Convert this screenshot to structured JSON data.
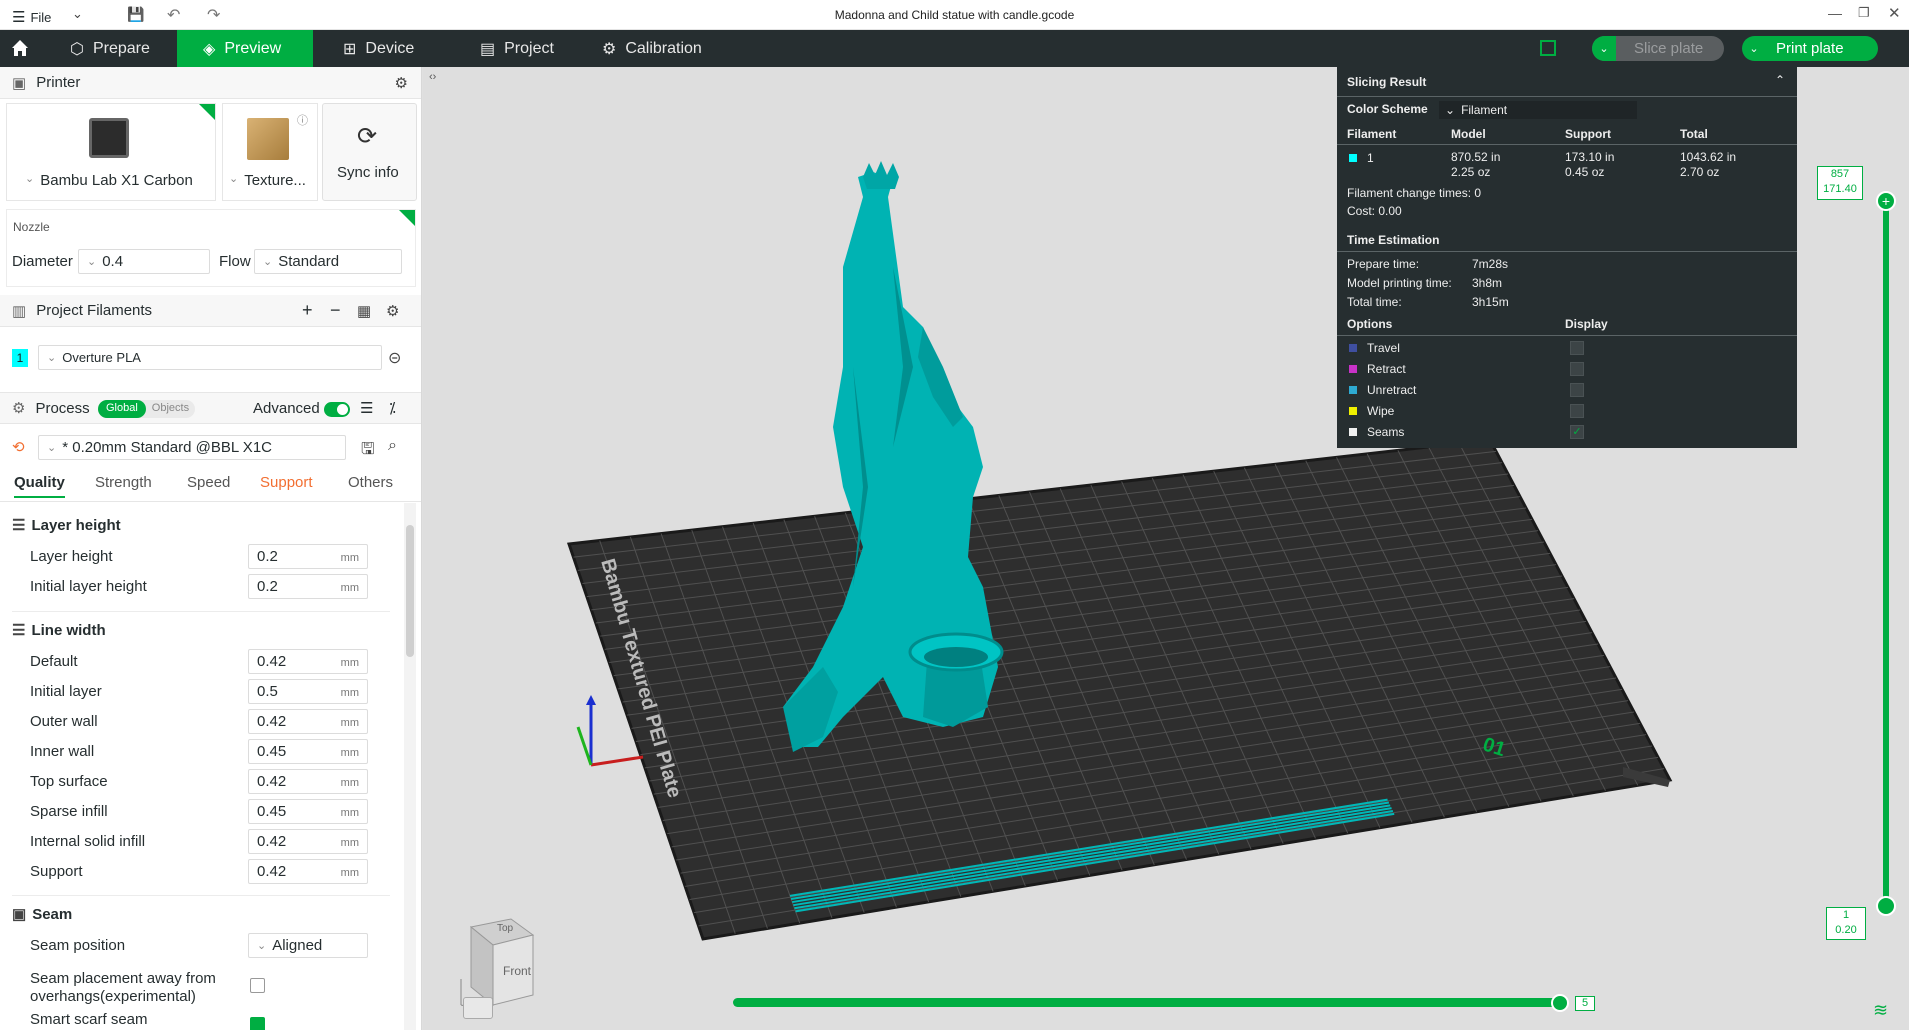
{
  "titlebar": {
    "file_label": "File",
    "title": "Madonna and Child statue with candle.gcode"
  },
  "nav": {
    "tabs": [
      {
        "label": "Prepare"
      },
      {
        "label": "Preview"
      },
      {
        "label": "Device"
      },
      {
        "label": "Project"
      },
      {
        "label": "Calibration"
      }
    ],
    "slice_label": "Slice plate",
    "print_label": "Print plate"
  },
  "printer": {
    "section_title": "Printer",
    "printer_name": "Bambu Lab X1 Carbon",
    "plate_name": "Texture...",
    "sync_label": "Sync info",
    "nozzle_title": "Nozzle",
    "diameter_label": "Diameter",
    "diameter_value": "0.4",
    "flow_label": "Flow",
    "flow_value": "Standard"
  },
  "filaments": {
    "section_title": "Project Filaments",
    "items": [
      {
        "index": "1",
        "name": "Overture PLA",
        "color": "#00ffff"
      }
    ]
  },
  "process": {
    "section_title": "Process",
    "global_label": "Global",
    "objects_label": "Objects",
    "advanced_label": "Advanced",
    "preset": "* 0.20mm Standard @BBL X1C",
    "tabs": [
      "Quality",
      "Strength",
      "Speed",
      "Support",
      "Others"
    ],
    "groups": [
      {
        "title": "Layer height",
        "params": [
          {
            "label": "Layer height",
            "value": "0.2",
            "unit": "mm"
          },
          {
            "label": "Initial layer height",
            "value": "0.2",
            "unit": "mm"
          }
        ]
      },
      {
        "title": "Line width",
        "params": [
          {
            "label": "Default",
            "value": "0.42",
            "unit": "mm"
          },
          {
            "label": "Initial layer",
            "value": "0.5",
            "unit": "mm"
          },
          {
            "label": "Outer wall",
            "value": "0.42",
            "unit": "mm"
          },
          {
            "label": "Inner wall",
            "value": "0.45",
            "unit": "mm"
          },
          {
            "label": "Top surface",
            "value": "0.42",
            "unit": "mm"
          },
          {
            "label": "Sparse infill",
            "value": "0.45",
            "unit": "mm"
          },
          {
            "label": "Internal solid infill",
            "value": "0.42",
            "unit": "mm"
          },
          {
            "label": "Support",
            "value": "0.42",
            "unit": "mm"
          }
        ]
      },
      {
        "title": "Seam",
        "params": [
          {
            "label": "Seam position",
            "value": "Aligned"
          },
          {
            "label": "Seam placement away from overhangs(experimental)"
          },
          {
            "label": "Smart scarf seam"
          }
        ]
      }
    ]
  },
  "slicing": {
    "title": "Slicing Result",
    "color_scheme_label": "Color Scheme",
    "color_scheme_value": "Filament",
    "columns": [
      "Filament",
      "Model",
      "Support",
      "Total"
    ],
    "rows": [
      {
        "filament": "1",
        "model_len": "870.52 in",
        "model_wt": "2.25 oz",
        "support_len": "173.10 in",
        "support_wt": "0.45 oz",
        "total_len": "1043.62 in",
        "total_wt": "2.70 oz"
      }
    ],
    "change_times": "Filament change times:  0",
    "cost": "Cost:  0.00",
    "time_title": "Time Estimation",
    "times": [
      {
        "label": "Prepare time:",
        "value": "7m28s"
      },
      {
        "label": "Model printing time:",
        "value": "3h8m"
      },
      {
        "label": "Total time:",
        "value": "3h15m"
      }
    ],
    "options_label": "Options",
    "display_label": "Display",
    "options": [
      {
        "label": "Travel",
        "color": "#3f4fa0",
        "checked": false
      },
      {
        "label": "Retract",
        "color": "#c832c8",
        "checked": false
      },
      {
        "label": "Unretract",
        "color": "#2eaad2",
        "checked": false
      },
      {
        "label": "Wipe",
        "color": "#f0f000",
        "checked": false
      },
      {
        "label": "Seams",
        "color": "#f0f0f0",
        "checked": true
      }
    ]
  },
  "layer_slider": {
    "top_layer": "857",
    "top_height": "171.40",
    "bottom_layer": "1",
    "bottom_height": "0.20"
  },
  "move_slider": {
    "value": "5"
  },
  "plate": {
    "label": "Bambu Textured PEI Plate",
    "number": "01"
  },
  "view_cube": {
    "top": "Top",
    "front": "Front"
  },
  "colors": {
    "accent": "#00ae42",
    "filament": "#00b8b8"
  }
}
